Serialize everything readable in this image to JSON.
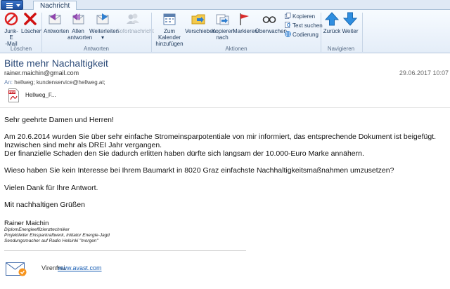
{
  "tabs": {
    "active_tab": "Nachricht"
  },
  "ribbon": {
    "groups": {
      "delete": "Löschen",
      "respond": "Antworten",
      "actions": "Aktionen",
      "navigate": "Navigieren"
    },
    "buttons": {
      "junk_line1": "Junk-E",
      "junk_line2": "-Mail",
      "delete": "Löschen",
      "reply": "Antworten",
      "reply_all_line1": "Allen",
      "reply_all_line2": "antworten",
      "forward": "Weiterleiten",
      "im": "Sofortnachricht",
      "calendar_line1": "Zum Kalender",
      "calendar_line2": "hinzufügen",
      "move": "Verschieben",
      "copy_to_line1": "Kopieren",
      "copy_to_line2": "nach",
      "flag": "Markieren",
      "watch": "Überwachen",
      "copy": "Kopieren",
      "find_text": "Text suchen",
      "encoding": "Codierung",
      "back": "Zurück",
      "next": "Weiter"
    }
  },
  "message": {
    "subject": "Bitte mehr Nachaltigkeit",
    "sender": "rainer.maichin@gmail.com",
    "date": "29.06.2017 10:07",
    "to_label": "An:",
    "to_value": "hellweg; kundenservice@hellweg.at;",
    "attachment_name": "Hellweg_F...",
    "body": [
      "Sehr geehrte Damen und Herren!",
      "Am 20.6.2014 wurden Sie über sehr einfache Stromeinsparpotentiale von mir informiert, das entsprechende Dokument ist beigefügt.",
      "Inzwischen sind mehr als DREI Jahr vergangen.",
      "Der finanzielle Schaden den Sie dadurch erlitten haben dürfte sich langsam der 10.000-Euro Marke annähern.",
      "Wieso haben Sie kein Interesse bei Ihrem Baumarkt in 8020 Graz einfachste Nachhaltigkeitsmaßnahmen umzusetzen?",
      "Vielen Dank für Ihre Antwort.",
      "Mit nachhaltigen Grüßen"
    ],
    "signature": {
      "name": "Rainer Maichin",
      "line1": "DiplomEnergieeffizienztechniker",
      "line2": "Projektleiter Einsparkraftwerk, Initiator Energie-Jagd",
      "line3": "Sendungsmacher auf Radio Helsinki \"morgen\""
    },
    "footer": {
      "label": "Virenfrei.",
      "link": "www.avast.com"
    }
  }
}
